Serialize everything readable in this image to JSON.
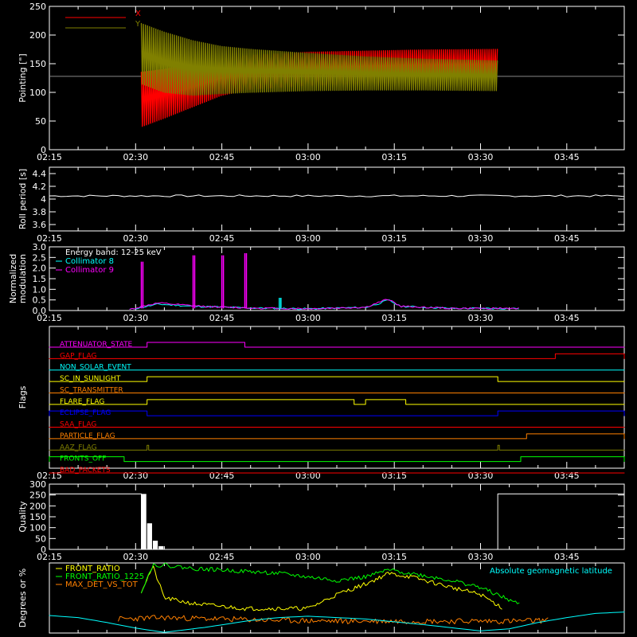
{
  "chart_data": [
    {
      "type": "line",
      "panel": "pointing",
      "ylabel": "Pointing [\"]",
      "ylim": [
        0,
        250
      ],
      "yticks": [
        0,
        50,
        100,
        150,
        200,
        250
      ],
      "xticks": [
        "02:15",
        "02:30",
        "02:45",
        "03:00",
        "03:15",
        "03:30",
        "03:45"
      ],
      "reference_line": 128,
      "series": [
        {
          "name": "X",
          "color": "#ff0000",
          "x": [
            "02:31",
            "02:35",
            "02:40",
            "02:45",
            "02:50",
            "03:00",
            "03:10",
            "03:20",
            "03:33"
          ],
          "upper": [
            135,
            140,
            150,
            160,
            165,
            170,
            172,
            174,
            175
          ],
          "lower": [
            40,
            55,
            75,
            95,
            105,
            112,
            115,
            118,
            120
          ]
        },
        {
          "name": "Y",
          "color": "#808000",
          "x": [
            "02:31",
            "02:35",
            "02:40",
            "02:45",
            "02:50",
            "03:00",
            "03:10",
            "03:20",
            "03:33"
          ],
          "upper": [
            220,
            205,
            190,
            180,
            175,
            168,
            162,
            158,
            155
          ],
          "lower": [
            115,
            100,
            95,
            98,
            100,
            103,
            104,
            104,
            103
          ]
        }
      ]
    },
    {
      "type": "line",
      "panel": "roll",
      "ylabel": "Roll period [s]",
      "ylim": [
        3.5,
        4.5
      ],
      "yticks": [
        3.6,
        3.8,
        4.0,
        4.2,
        4.4
      ],
      "xticks": [
        "02:15",
        "02:30",
        "02:45",
        "03:00",
        "03:15",
        "03:30",
        "03:45"
      ],
      "series": [
        {
          "name": "",
          "color": "#ffffff",
          "x": [
            "02:15",
            "03:55"
          ],
          "y": [
            4.05,
            4.05
          ]
        }
      ]
    },
    {
      "type": "line",
      "panel": "modulation",
      "ylabel": "Normalized modulation",
      "ylim": [
        0,
        3.0
      ],
      "yticks": [
        "0.0",
        "0.5",
        "1.0",
        "1.5",
        "2.0",
        "2.5",
        "3.0"
      ],
      "xticks": [
        "02:15",
        "02:30",
        "02:45",
        "03:00",
        "03:15",
        "03:30",
        "03:45"
      ],
      "legend_title": "Energy band: 12-25 keV",
      "series": [
        {
          "name": "Collimator 8",
          "color": "#00ffff",
          "x": [
            "02:29",
            "02:32",
            "02:34",
            "02:40",
            "02:46",
            "02:50",
            "03:00",
            "03:10",
            "03:12",
            "03:14",
            "03:16",
            "03:25",
            "03:37"
          ],
          "y": [
            0.05,
            0.2,
            0.3,
            0.2,
            0.15,
            0.12,
            0.08,
            0.15,
            0.3,
            0.5,
            0.2,
            0.1,
            0.1
          ]
        },
        {
          "name": "Collimator 9",
          "color": "#ff00ff",
          "x": [
            "02:29",
            "02:32",
            "02:34",
            "02:40",
            "02:46",
            "02:50",
            "03:00",
            "03:10",
            "03:12",
            "03:14",
            "03:16",
            "03:25",
            "03:37"
          ],
          "y": [
            0.05,
            0.25,
            0.35,
            0.22,
            0.15,
            0.12,
            0.08,
            0.15,
            0.35,
            0.55,
            0.2,
            0.1,
            0.1
          ]
        }
      ],
      "spikes": [
        {
          "x": "02:31",
          "y": 2.3,
          "color": "#ff00ff"
        },
        {
          "x": "02:40",
          "y": 2.6,
          "color": "#ff00ff"
        },
        {
          "x": "02:45",
          "y": 2.6,
          "color": "#ff00ff"
        },
        {
          "x": "02:49",
          "y": 2.7,
          "color": "#ff00ff"
        },
        {
          "x": "02:55",
          "y": 0.6,
          "color": "#00ffff"
        }
      ]
    },
    {
      "type": "line",
      "panel": "flags",
      "ylabel": "Flags",
      "xticks": [
        "02:15",
        "02:30",
        "02:45",
        "03:00",
        "03:15",
        "03:30",
        "03:45"
      ],
      "flags": [
        {
          "name": "ATTENUATOR_STATE",
          "color": "#ff00ff",
          "on": [
            [
              "02:32",
              "02:49"
            ]
          ]
        },
        {
          "name": "GAP_FLAG",
          "color": "#ff0000",
          "on": [
            [
              "03:43",
              "03:55"
            ]
          ]
        },
        {
          "name": "NON_SOLAR_EVENT",
          "color": "#00ffff",
          "on": []
        },
        {
          "name": "SC_IN_SUNLIGHT",
          "color": "#ffff00",
          "on": [
            [
              "02:32",
              "03:33"
            ]
          ]
        },
        {
          "name": "SC_TRANSMITTER",
          "color": "#ff8000",
          "on": []
        },
        {
          "name": "FLARE_FLAG",
          "color": "#ffff00",
          "on": [
            [
              "02:32",
              "03:08"
            ],
            [
              "03:10",
              "03:17"
            ]
          ]
        },
        {
          "name": "ECLIPSE_FLAG",
          "color": "#0000ff",
          "on": [
            [
              "02:15",
              "02:32"
            ],
            [
              "03:33",
              "03:55"
            ]
          ]
        },
        {
          "name": "SAA_FLAG",
          "color": "#ff0000",
          "on": []
        },
        {
          "name": "PARTICLE_FLAG",
          "color": "#ff8000",
          "on": [
            [
              "03:38",
              "03:55"
            ]
          ]
        },
        {
          "name": "AAZ_FLAG",
          "color": "#808000",
          "on": [
            [
              "02:32",
              "02:32"
            ],
            [
              "03:33",
              "03:33"
            ]
          ]
        },
        {
          "name": "FRONTS_OFF",
          "color": "#00ff00",
          "on": [
            [
              "02:15",
              "02:28"
            ],
            [
              "03:37",
              "03:55"
            ]
          ]
        },
        {
          "name": "BAD_PACKETS",
          "color": "#ff0000",
          "on": []
        }
      ]
    },
    {
      "type": "bar",
      "panel": "quality",
      "ylabel": "Quality",
      "ylim": [
        0,
        300
      ],
      "yticks": [
        0,
        50,
        100,
        150,
        200,
        250,
        300
      ],
      "xticks": [
        "02:15",
        "02:30",
        "02:45",
        "03:00",
        "03:15",
        "03:30",
        "03:45"
      ],
      "bars": [
        {
          "x0": "02:15",
          "x1": "02:31",
          "y": 255
        },
        {
          "x0": "02:31",
          "x1": "02:32",
          "y": 255
        },
        {
          "x0": "02:32",
          "x1": "02:33",
          "y": 120
        },
        {
          "x0": "02:33",
          "x1": "02:34",
          "y": 40
        },
        {
          "x0": "02:34",
          "x1": "02:35",
          "y": 15
        },
        {
          "x0": "03:33",
          "x1": "03:55",
          "y": 255
        }
      ]
    },
    {
      "type": "line",
      "panel": "ratios",
      "ylabel": "Degrees or %",
      "ylim": [
        0,
        100
      ],
      "xticks": [],
      "annotation": "Absolute geomagnetic latitude",
      "series": [
        {
          "name": "FRONT_RATIO",
          "color": "#ffff00",
          "x": [
            "02:31",
            "02:33",
            "02:35",
            "02:40",
            "02:45",
            "02:49",
            "02:55",
            "03:00",
            "03:05",
            "03:10",
            "03:14",
            "03:18",
            "03:25",
            "03:30",
            "03:34"
          ],
          "y": [
            60,
            95,
            50,
            42,
            38,
            35,
            35,
            35,
            55,
            70,
            85,
            80,
            65,
            55,
            35
          ]
        },
        {
          "name": "FRONT_RATIO_1225",
          "color": "#00ff00",
          "x": [
            "02:31",
            "02:33",
            "02:35",
            "02:40",
            "02:45",
            "02:49",
            "02:55",
            "03:00",
            "03:05",
            "03:10",
            "03:14",
            "03:18",
            "03:25",
            "03:30",
            "03:37"
          ],
          "y": [
            60,
            97,
            97,
            92,
            90,
            88,
            85,
            80,
            75,
            80,
            90,
            85,
            75,
            65,
            40
          ]
        },
        {
          "name": "MAX_DET_VS_TOT",
          "color": "#ff8000",
          "x": [
            "02:27",
            "02:35",
            "02:45",
            "02:55",
            "03:05",
            "03:15",
            "03:25",
            "03:35",
            "03:42"
          ],
          "y": [
            20,
            22,
            20,
            18,
            17,
            17,
            17,
            17,
            18
          ]
        },
        {
          "name": "",
          "color": "#00ffff",
          "x": [
            "02:15",
            "02:20",
            "02:25",
            "02:30",
            "02:35",
            "02:42",
            "02:50",
            "02:55",
            "03:00",
            "03:10",
            "03:20",
            "03:30",
            "03:35",
            "03:40",
            "03:45",
            "03:50",
            "03:55"
          ],
          "y": [
            25,
            22,
            15,
            7,
            1,
            8,
            18,
            22,
            24,
            20,
            12,
            3,
            6,
            15,
            22,
            28,
            30
          ]
        }
      ]
    }
  ]
}
